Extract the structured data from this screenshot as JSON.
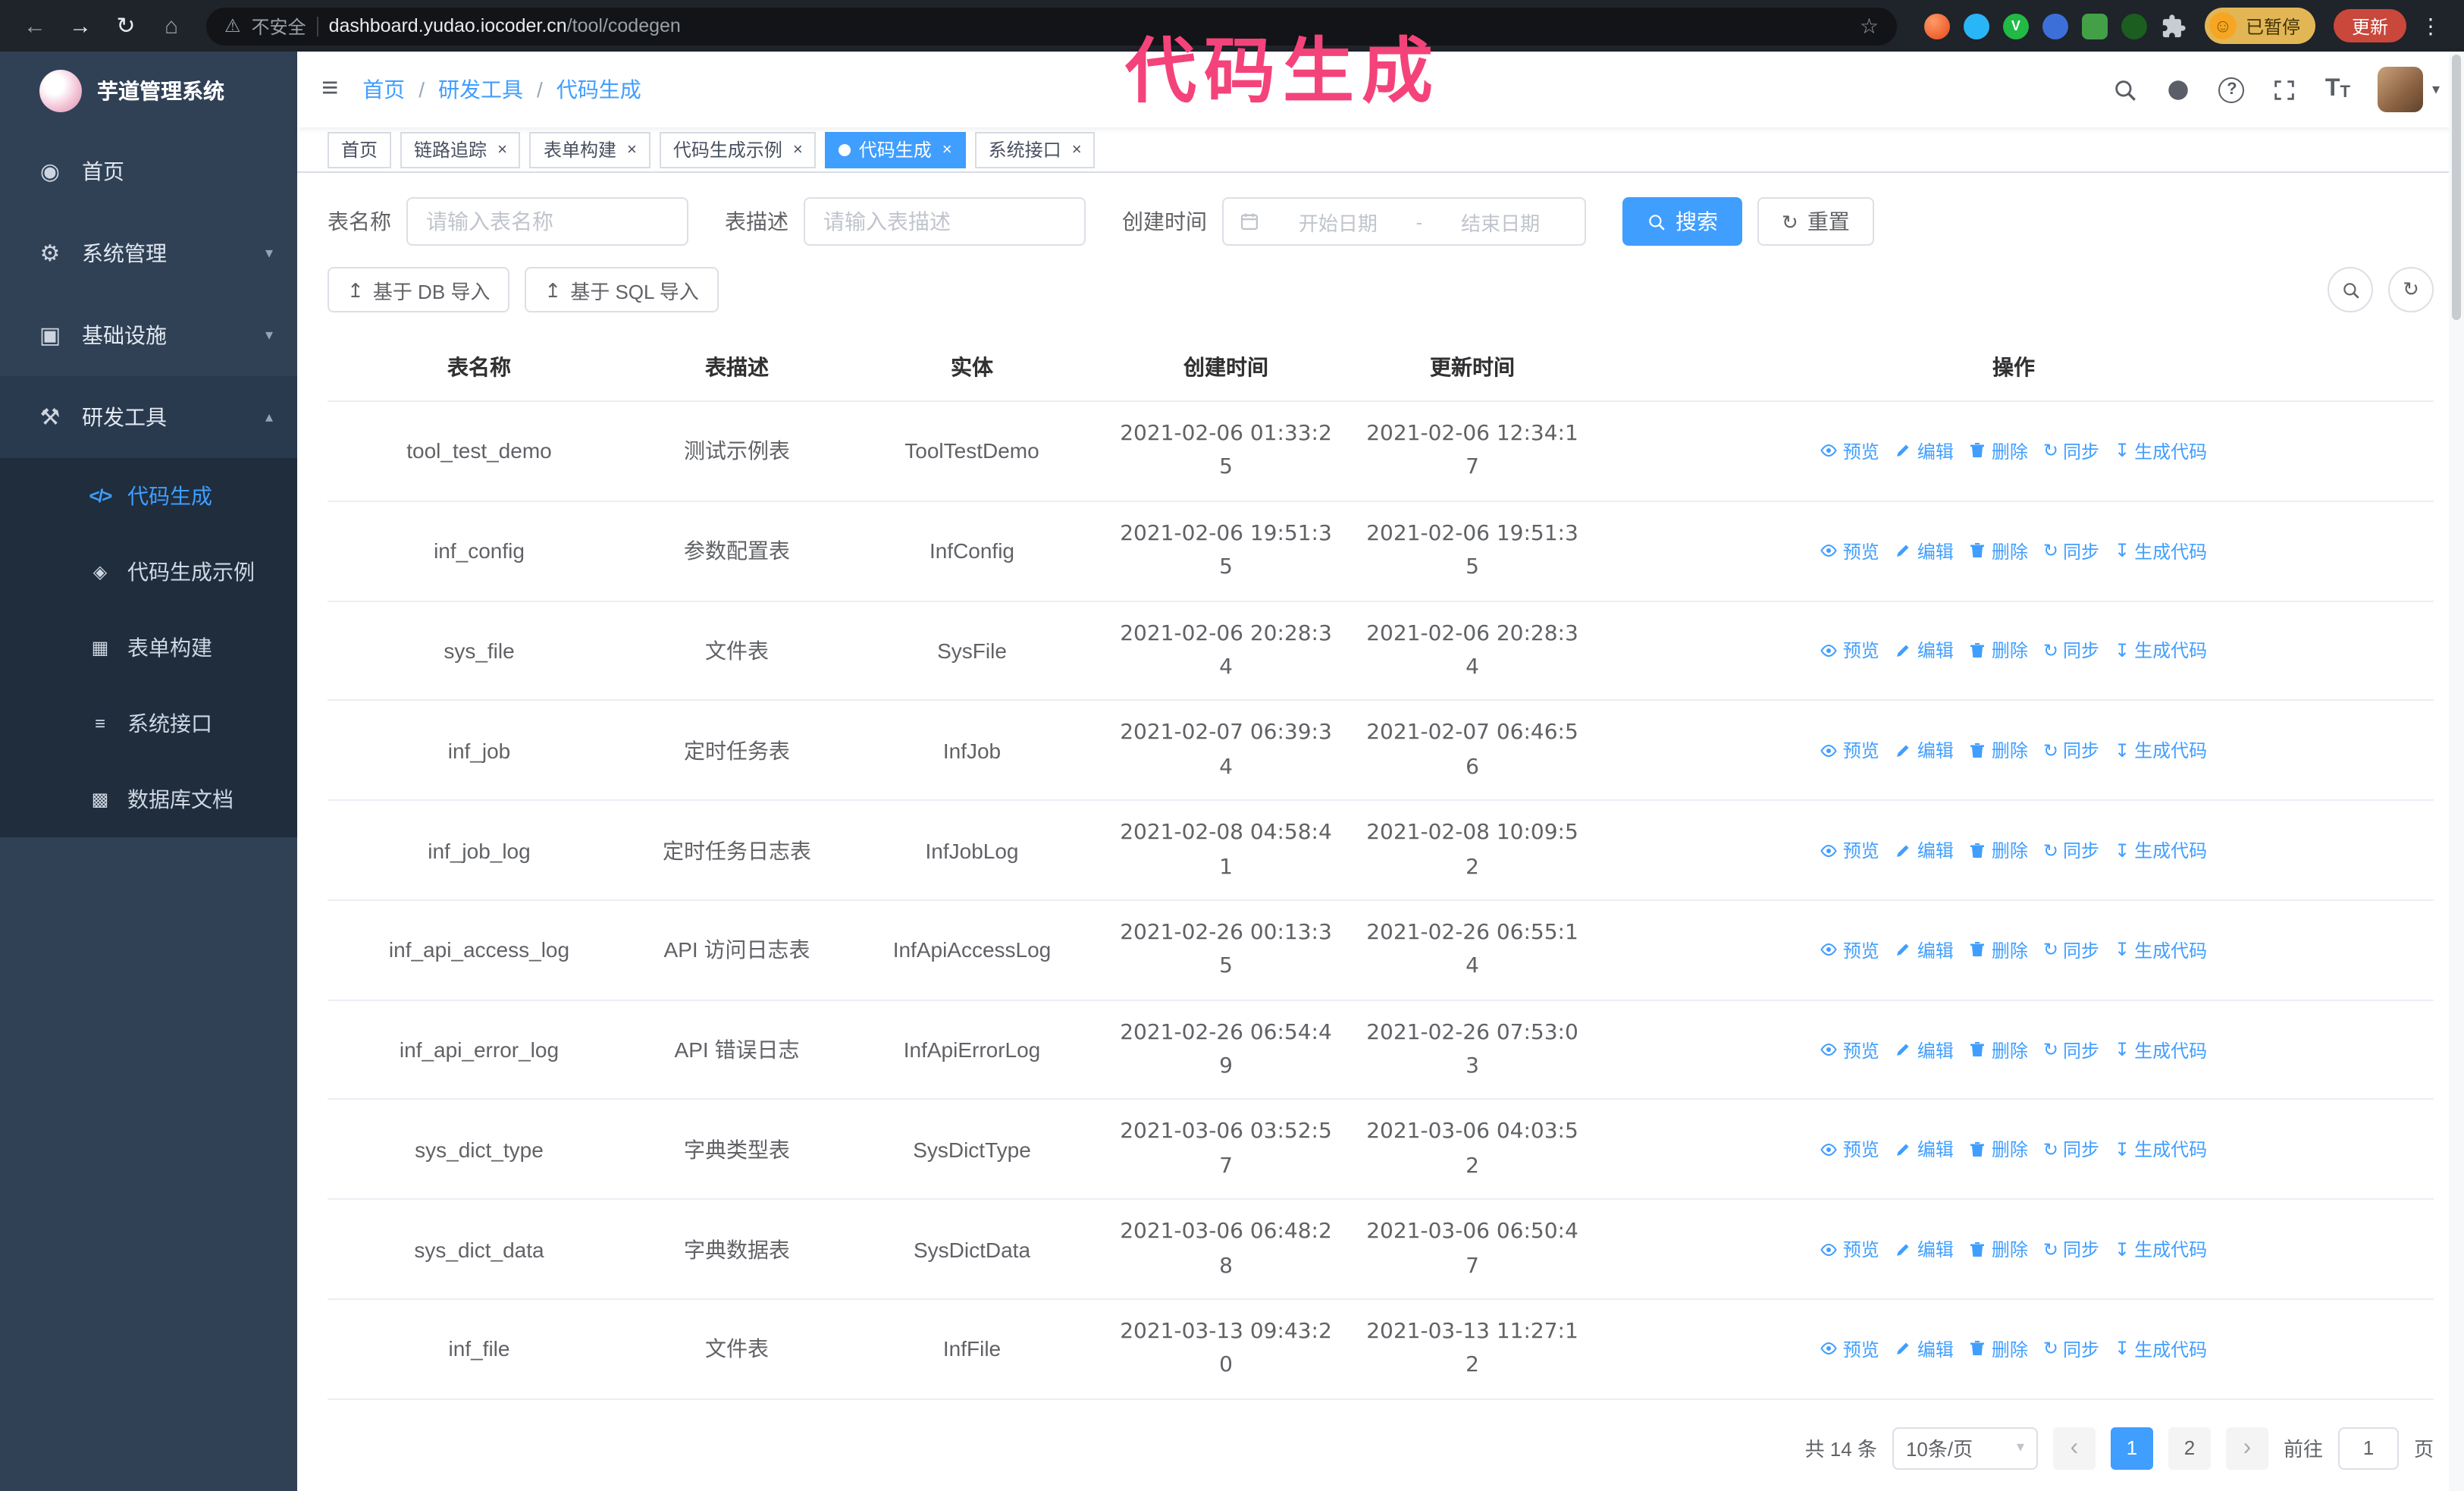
{
  "annotation": {
    "text": "代码生成"
  },
  "glyphs": {
    "back": "←",
    "forward": "→",
    "reload": "↻",
    "home": "⌂",
    "warning": "⚠",
    "star": "☆",
    "kebab": "⋮",
    "menu": "≡",
    "chevron_down": "▾",
    "chevron_up": "▴",
    "breadcrumb_sep": "/",
    "caret_down": "▾",
    "close": "×",
    "upload": "↥",
    "sync": "↻",
    "download": "↧",
    "date_sep": "-",
    "prev": "‹",
    "next": "›",
    "help": "?",
    "text_size_big": "T",
    "text_size_small": "T",
    "smiley": "☺",
    "ext_v": "V"
  },
  "browser": {
    "security_label": "不安全",
    "url_domain": "dashboard.yudao.iocoder.cn",
    "url_path": "/tool/codegen",
    "profile_chip": "已暂停",
    "update_label": "更新"
  },
  "sidebar": {
    "logo_title": "芋道管理系统",
    "items": [
      {
        "icon": "◉",
        "label": "首页"
      },
      {
        "icon": "⚙",
        "label": "系统管理"
      },
      {
        "icon": "▣",
        "label": "基础设施"
      },
      {
        "icon": "⚒",
        "label": "研发工具"
      }
    ],
    "subitems": [
      {
        "icon": "</>",
        "label": "代码生成"
      },
      {
        "icon": "◈",
        "label": "代码生成示例"
      },
      {
        "icon": "▦",
        "label": "表单构建"
      },
      {
        "icon": "≡",
        "label": "系统接口"
      },
      {
        "icon": "▩",
        "label": "数据库文档"
      }
    ]
  },
  "navbar": {
    "breadcrumb": [
      "首页",
      "研发工具",
      "代码生成"
    ]
  },
  "tabs": {
    "items": [
      "首页",
      "链路追踪",
      "表单构建",
      "代码生成示例",
      "代码生成",
      "系统接口"
    ]
  },
  "filters": {
    "table_name_label": "表名称",
    "table_name_placeholder": "请输入表名称",
    "table_desc_label": "表描述",
    "table_desc_placeholder": "请输入表描述",
    "created_label": "创建时间",
    "date_start_placeholder": "开始日期",
    "date_end_placeholder": "结束日期",
    "search_button": "搜索",
    "reset_button": "重置"
  },
  "toolbar": {
    "import_db_label": "基于 DB 导入",
    "import_sql_label": "基于 SQL 导入"
  },
  "table": {
    "columns": [
      "表名称",
      "表描述",
      "实体",
      "创建时间",
      "更新时间",
      "操作"
    ],
    "action_labels": [
      "预览",
      "编辑",
      "删除",
      "同步",
      "生成代码"
    ],
    "rows": [
      {
        "name": "tool_test_demo",
        "desc": "测试示例表",
        "entity": "ToolTestDemo",
        "created": "2021-02-06 01:33:25",
        "updated": "2021-02-06 12:34:17"
      },
      {
        "name": "inf_config",
        "desc": "参数配置表",
        "entity": "InfConfig",
        "created": "2021-02-06 19:51:35",
        "updated": "2021-02-06 19:51:35"
      },
      {
        "name": "sys_file",
        "desc": "文件表",
        "entity": "SysFile",
        "created": "2021-02-06 20:28:34",
        "updated": "2021-02-06 20:28:34"
      },
      {
        "name": "inf_job",
        "desc": "定时任务表",
        "entity": "InfJob",
        "created": "2021-02-07 06:39:34",
        "updated": "2021-02-07 06:46:56"
      },
      {
        "name": "inf_job_log",
        "desc": "定时任务日志表",
        "entity": "InfJobLog",
        "created": "2021-02-08 04:58:41",
        "updated": "2021-02-08 10:09:52"
      },
      {
        "name": "inf_api_access_log",
        "desc": "API 访问日志表",
        "entity": "InfApiAccessLog",
        "created": "2021-02-26 00:13:35",
        "updated": "2021-02-26 06:55:14"
      },
      {
        "name": "inf_api_error_log",
        "desc": "API 错误日志",
        "entity": "InfApiErrorLog",
        "created": "2021-02-26 06:54:49",
        "updated": "2021-02-26 07:53:03"
      },
      {
        "name": "sys_dict_type",
        "desc": "字典类型表",
        "entity": "SysDictType",
        "created": "2021-03-06 03:52:57",
        "updated": "2021-03-06 04:03:52"
      },
      {
        "name": "sys_dict_data",
        "desc": "字典数据表",
        "entity": "SysDictData",
        "created": "2021-03-06 06:48:28",
        "updated": "2021-03-06 06:50:47"
      },
      {
        "name": "inf_file",
        "desc": "文件表",
        "entity": "InfFile",
        "created": "2021-03-13 09:43:20",
        "updated": "2021-03-13 11:27:12"
      }
    ]
  },
  "pagination": {
    "total_text": "共 14 条",
    "page_size": "10条/页",
    "page_1": "1",
    "page_2": "2",
    "goto_label": "前往",
    "goto_value": "1",
    "page_unit": "页"
  },
  "colors": {
    "primary": "#409EFF",
    "sidebar_bg": "#304156",
    "submenu_bg": "#1f2d3d",
    "annotation_pink": "#f4437a",
    "update_red": "#c9473b"
  }
}
